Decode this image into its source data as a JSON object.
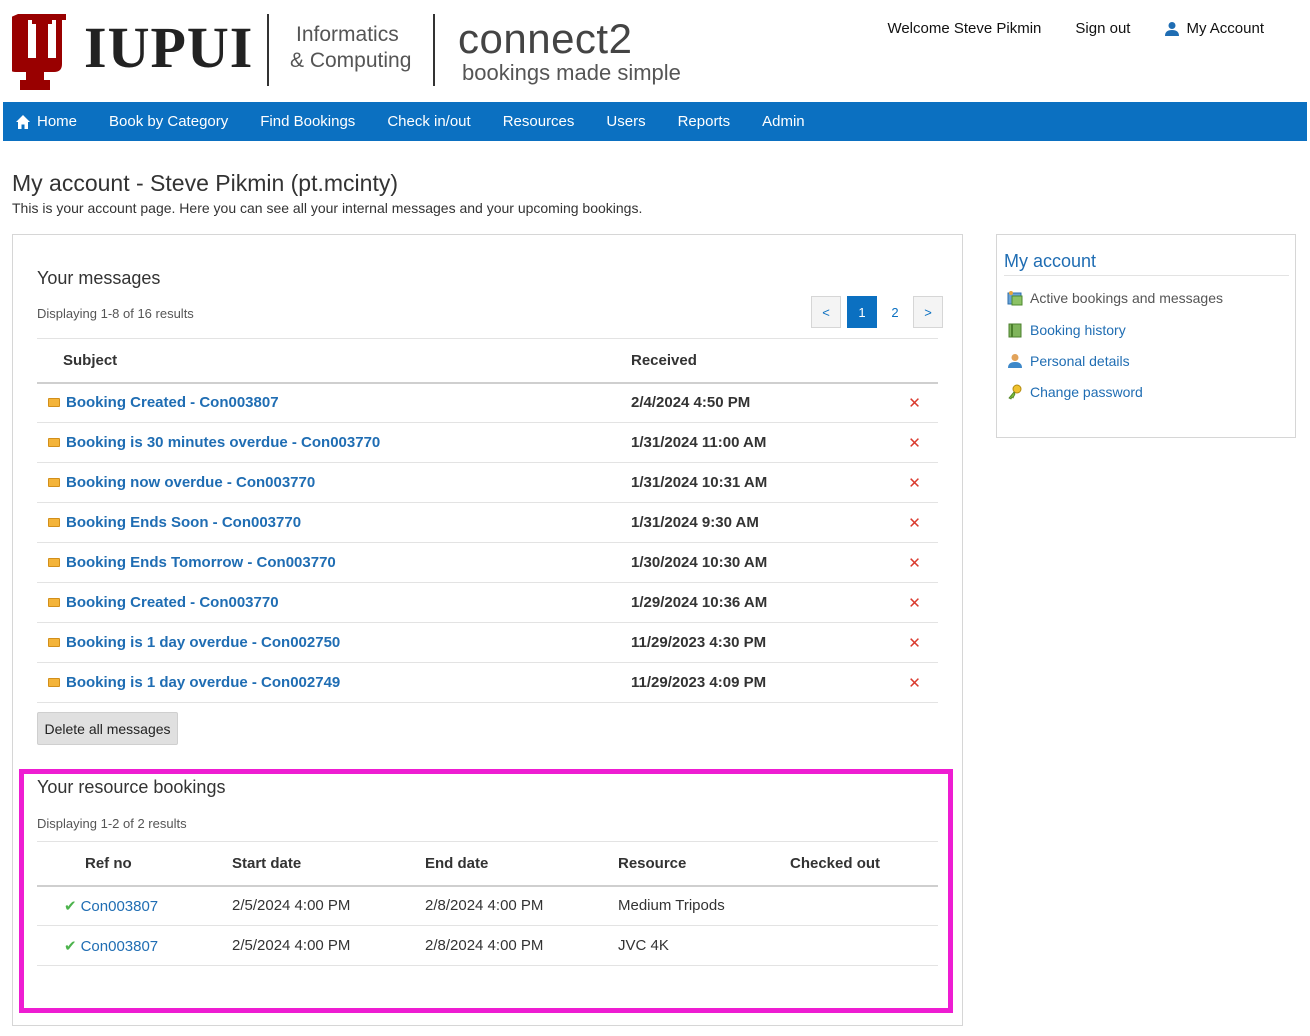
{
  "header": {
    "logo_text": "IUPUI",
    "dept_line1": "Informatics",
    "dept_line2": "& Computing",
    "brand_name": "connect2",
    "brand_tag": "bookings made simple",
    "welcome": "Welcome Steve Pikmin",
    "sign_out": "Sign out",
    "my_account": "My Account"
  },
  "nav": {
    "items": [
      "Home",
      "Book by Category",
      "Find Bookings",
      "Check in/out",
      "Resources",
      "Users",
      "Reports",
      "Admin"
    ]
  },
  "page": {
    "title": "My account - Steve Pikmin (pt.mcinty)",
    "subtitle": "This is your account page. Here you can see all your internal messages and your upcoming bookings."
  },
  "messages": {
    "title": "Your messages",
    "count": "Displaying 1-8 of 16 results",
    "pager": [
      "<",
      "1",
      "2",
      ">"
    ],
    "columns": [
      "Subject",
      "Received"
    ],
    "rows": [
      {
        "subject": "Booking Created - Con003807",
        "received": "2/4/2024 4:50 PM"
      },
      {
        "subject": "Booking is 30 minutes overdue - Con003770",
        "received": "1/31/2024 11:00 AM"
      },
      {
        "subject": "Booking now overdue - Con003770",
        "received": "1/31/2024 10:31 AM"
      },
      {
        "subject": "Booking Ends Soon - Con003770",
        "received": "1/31/2024 9:30 AM"
      },
      {
        "subject": "Booking Ends Tomorrow - Con003770",
        "received": "1/30/2024 10:30 AM"
      },
      {
        "subject": "Booking Created - Con003770",
        "received": "1/29/2024 10:36 AM"
      },
      {
        "subject": "Booking is 1 day overdue - Con002750",
        "received": "11/29/2023 4:30 PM"
      },
      {
        "subject": "Booking is 1 day overdue - Con002749",
        "received": "11/29/2023 4:09 PM"
      }
    ],
    "delete_all": "Delete all messages"
  },
  "bookings": {
    "title": "Your resource bookings",
    "count": "Displaying 1-2 of 2 results",
    "columns": [
      "Ref no",
      "Start date",
      "End date",
      "Resource",
      "Checked out"
    ],
    "rows": [
      {
        "ref": "Con003807",
        "start": "2/5/2024 4:00 PM",
        "end": "2/8/2024 4:00 PM",
        "resource": "Medium Tripods",
        "checked_out": ""
      },
      {
        "ref": "Con003807",
        "start": "2/5/2024 4:00 PM",
        "end": "2/8/2024 4:00 PM",
        "resource": "JVC 4K",
        "checked_out": ""
      }
    ]
  },
  "sidebar": {
    "title": "My account",
    "items": [
      {
        "label": "Active bookings and messages",
        "icon": "bookings-icon"
      },
      {
        "label": "Booking history",
        "icon": "history-icon"
      },
      {
        "label": "Personal details",
        "icon": "user-icon"
      },
      {
        "label": "Change password",
        "icon": "key-icon"
      }
    ]
  },
  "colors": {
    "nav_bg": "#0b70c1",
    "link": "#1f6db3",
    "highlight": "#ee1dd2",
    "delete_x": "#d93a2e",
    "logo_red": "#990000"
  }
}
